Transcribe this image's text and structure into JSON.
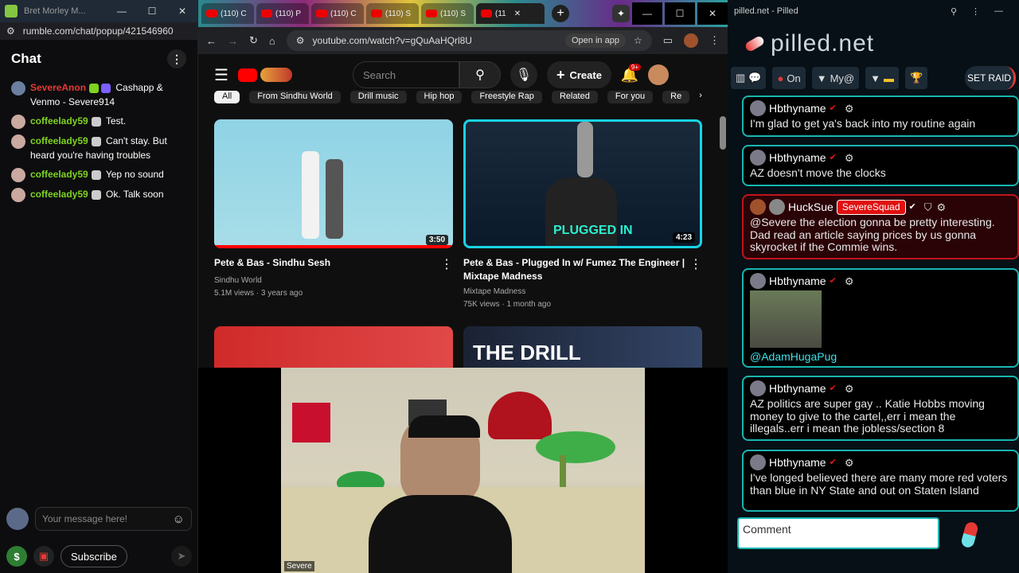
{
  "rumble": {
    "window_title": "Bret Morley M...",
    "url": "rumble.com/chat/popup/421546960",
    "chat_title": "Chat",
    "messages": [
      {
        "user": "SevereAnon",
        "color": "#e53935",
        "text": "Cashapp & Venmo - Severe914"
      },
      {
        "user": "coffeelady59",
        "color": "#7ed321",
        "text": "Test."
      },
      {
        "user": "coffeelady59",
        "color": "#7ed321",
        "text": "Can't stay. But heard you're having troubles"
      },
      {
        "user": "coffeelady59",
        "color": "#7ed321",
        "text": "Yep no sound"
      },
      {
        "user": "coffeelady59",
        "color": "#7ed321",
        "text": "Ok. Talk soon"
      }
    ],
    "input_placeholder": "Your message here!",
    "subscribe_label": "Subscribe"
  },
  "youtube": {
    "tabs": [
      "(110) C",
      "(110) P",
      "(110) C",
      "(110) S",
      "(110) S",
      "(11"
    ],
    "url": "youtube.com/watch?v=gQuAaHQrl8U",
    "open_in_app": "Open in app",
    "search_placeholder": "Search",
    "create_label": "Create",
    "notif_count": "9+",
    "chips": [
      "All",
      "From Sindhu World",
      "Drill music",
      "Hip hop",
      "Freestyle Rap",
      "Related",
      "For you",
      "Re"
    ],
    "videos": [
      {
        "title": "Pete & Bas - Sindhu Sesh",
        "channel": "Sindhu World",
        "meta": "5.1M views · 3 years ago",
        "duration": "3:50"
      },
      {
        "title": "Pete & Bas - Plugged In w/ Fumez The Engineer | Mixtape Madness",
        "channel": "Mixtape Madness",
        "meta": "75K views · 1 month ago",
        "duration": "4:23"
      }
    ],
    "thumb_text": "THE DRILL"
  },
  "webcam": {
    "label": "Severe"
  },
  "pilled": {
    "window_title": "pilled.net - Pilled",
    "logo": "pilled.net",
    "toolbar": {
      "on_label": "On",
      "my_label": "My@",
      "raid_label": "SET RAID"
    },
    "messages": [
      {
        "user": "Hbthyname",
        "text": "I'm glad to get ya's back into my routine again",
        "style": "normal"
      },
      {
        "user": "Hbthyname",
        "text": "AZ doesn't move the clocks",
        "style": "normal"
      },
      {
        "user": "HuckSue",
        "badge": "SevereSquad",
        "text": "@Severe the election gonna be pretty interesting. Dad read an article saying prices by us gonna skyrocket if the Commie wins.",
        "style": "red"
      },
      {
        "user": "Hbthyname",
        "text": "@AdamHugaPug",
        "style": "image"
      },
      {
        "user": "Hbthyname",
        "text": "AZ politics are super gay .. Katie Hobbs moving money to give to the cartel,,err i mean the illegals..err i mean the jobless/section 8",
        "style": "normal"
      },
      {
        "user": "Hbthyname",
        "text": "I've longed believed there are many more red voters than blue in NY State and out on Staten Island",
        "style": "normal"
      }
    ],
    "comment_placeholder": "Comment"
  }
}
